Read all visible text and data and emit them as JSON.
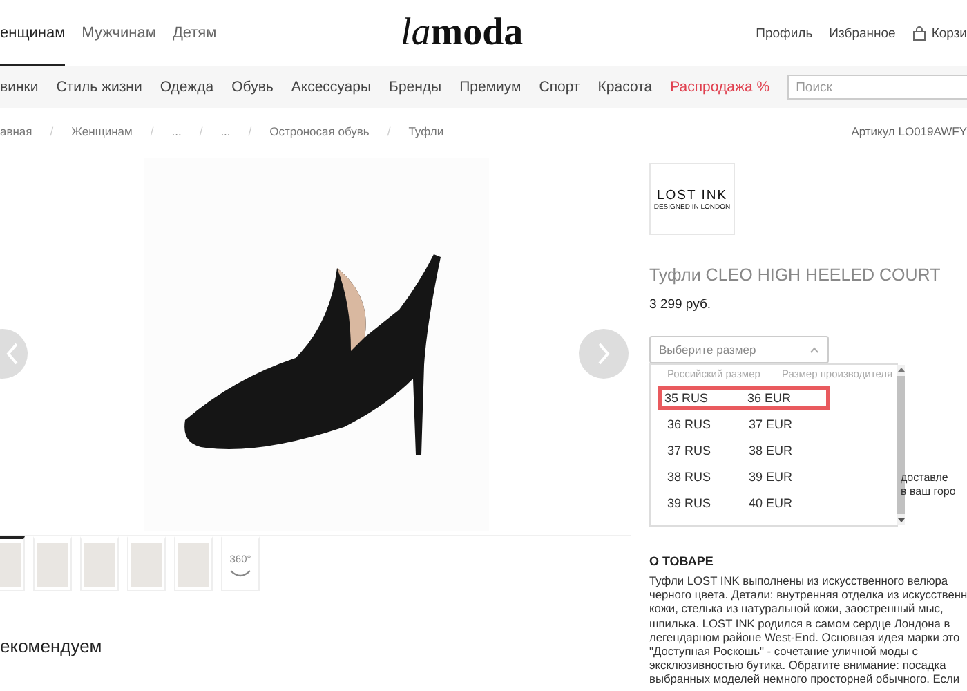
{
  "top_nav": {
    "tabs": [
      {
        "label": "енщинам",
        "selected": true
      },
      {
        "label": "Мужчинам",
        "selected": false
      },
      {
        "label": "Детям",
        "selected": false
      }
    ],
    "logo": {
      "italic": "la",
      "bold": "moda"
    },
    "links": [
      "Профиль",
      "Избранное"
    ],
    "cart": "Корзи"
  },
  "categories": [
    {
      "label": "винки",
      "sale": false
    },
    {
      "label": "Стиль жизни",
      "sale": false
    },
    {
      "label": "Одежда",
      "sale": false
    },
    {
      "label": "Обувь",
      "sale": false
    },
    {
      "label": "Аксессуары",
      "sale": false
    },
    {
      "label": "Бренды",
      "sale": false
    },
    {
      "label": "Премиум",
      "sale": false
    },
    {
      "label": "Спорт",
      "sale": false
    },
    {
      "label": "Красота",
      "sale": false
    },
    {
      "label": "Распродажа %",
      "sale": true
    }
  ],
  "search": {
    "placeholder": "Поиск"
  },
  "breadcrumbs": {
    "separator": "/",
    "items": [
      "авная",
      "Женщинам",
      "...",
      "...",
      "Остроносая обувь",
      "Туфли"
    ],
    "article": "Артикул LO019AWFY"
  },
  "thumbnails": [
    {
      "kind": "photo",
      "selected": true
    },
    {
      "kind": "photo",
      "selected": false
    },
    {
      "kind": "photo",
      "selected": false
    },
    {
      "kind": "photo",
      "selected": false
    },
    {
      "kind": "photo",
      "selected": false
    },
    {
      "kind": "view360",
      "selected": false,
      "label": "360°"
    }
  ],
  "recommend_heading": "екомендуем",
  "product": {
    "brand_logo": {
      "name": "LOST INK",
      "tagline": "DESIGNED IN LONDON"
    },
    "title": "Туфли CLEO HIGH HEELED COURT",
    "price": "3 299 руб.",
    "size_select": {
      "placeholder": "Выберите размер",
      "expanded": true,
      "columns": [
        "Российский размер",
        "Размер производителя"
      ],
      "rows": [
        {
          "ru": "35 RUS",
          "eu": "36 EUR",
          "selected": true
        },
        {
          "ru": "36 RUS",
          "eu": "37 EUR",
          "selected": false
        },
        {
          "ru": "37 RUS",
          "eu": "38 EUR",
          "selected": false
        },
        {
          "ru": "38 RUS",
          "eu": "39 EUR",
          "selected": false
        },
        {
          "ru": "39 RUS",
          "eu": "40 EUR",
          "selected": false
        }
      ]
    },
    "delivery_lines": [
      "доставле",
      "в ваш горо"
    ],
    "about_heading": "О ТОВАРЕ",
    "description_lines": [
      "Туфли LOST INK выполнены из искусственного велюра",
      "черного цвета. Детали: внутренняя отделка из искусственн",
      "кожи, стелька из натуральной кожи, заостренный мыс,",
      "шпилька. LOST INK родился в самом сердце Лондона в",
      "легендарном районе West-End. Основная идея марки это",
      "\"Доступная Роскошь\" - сочетание уличной моды с",
      "эксклюзивностью бутика. Обратите внимание: посадка",
      "выбранных моделей немного просторней обычного. Если"
    ]
  }
}
